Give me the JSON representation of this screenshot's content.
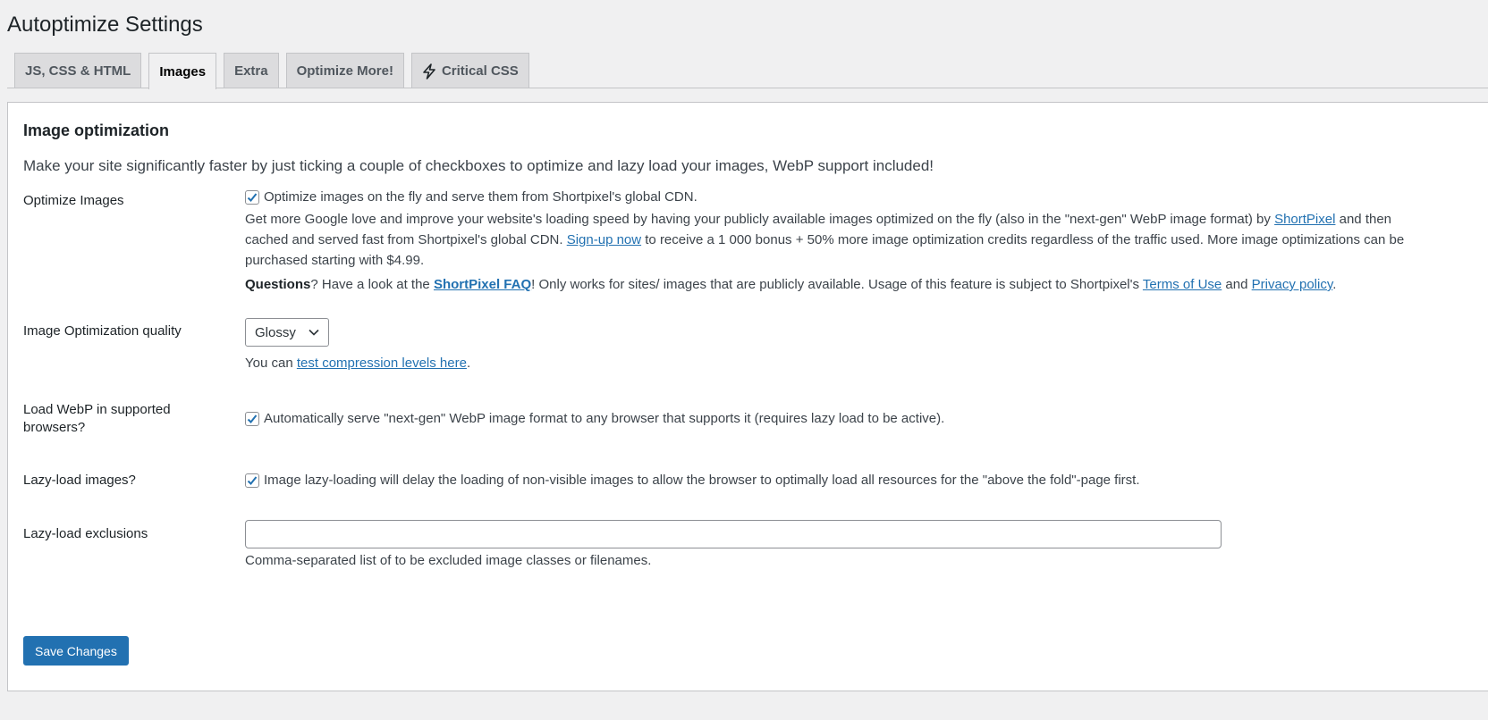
{
  "page": {
    "title": "Autoptimize Settings"
  },
  "tabs": [
    {
      "label": "JS, CSS & HTML"
    },
    {
      "label": "Images"
    },
    {
      "label": "Extra"
    },
    {
      "label": "Optimize More!"
    },
    {
      "label": "Critical CSS"
    }
  ],
  "active_tab": "Images",
  "section": {
    "title": "Image optimization",
    "intro": "Make your site significantly faster by just ticking a couple of checkboxes to optimize and lazy load your images, WebP support included!"
  },
  "optimize_images": {
    "label": "Optimize Images",
    "checked": true,
    "checkbox_text": "Optimize images on the fly and serve them from Shortpixel's global CDN.",
    "desc_part1": "Get more Google love and improve your website's loading speed by having your publicly available images optimized on the fly (also in the \"next-gen\" WebP image format) by ",
    "desc_link_shortpixel": "ShortPixel",
    "desc_part2": " and then",
    "desc_part3": "cached and served fast from Shortpixel's global CDN. ",
    "desc_link_signup": "Sign-up now",
    "desc_part4": " to receive a 1 000 bonus + 50% more image optimization credits regardless of the traffic used. More image optimizations can be",
    "desc_part5": "purchased starting with $4.99.",
    "questions_bold": "Questions",
    "questions_part1": "? Have a look at the ",
    "questions_link_faq": "ShortPixel FAQ",
    "questions_part2": "! Only works for sites/ images that are publicly available. Usage of this feature is subject to Shortpixel's ",
    "questions_link_terms": "Terms of Use",
    "questions_and": " and ",
    "questions_link_privacy": "Privacy policy",
    "questions_end": "."
  },
  "quality": {
    "label": "Image Optimization quality",
    "selected": "Glossy",
    "note_prefix": "You can ",
    "note_link": "test compression levels here",
    "note_suffix": "."
  },
  "webp": {
    "label": "Load WebP in supported browsers?",
    "checked": true,
    "checkbox_text": "Automatically serve \"next-gen\" WebP image format to any browser that supports it (requires lazy load to be active)."
  },
  "lazyload": {
    "label": "Lazy-load images?",
    "checked": true,
    "checkbox_text": "Image lazy-loading will delay the loading of non-visible images to allow the browser to optimally load all resources for the \"above the fold\"-page first."
  },
  "exclusions": {
    "label": "Lazy-load exclusions",
    "value": "",
    "note": "Comma-separated list of to be excluded image classes or filenames."
  },
  "save_button": {
    "label": "Save Changes"
  },
  "colors": {
    "accent": "#2271b1",
    "page_bg": "#f0f0f1",
    "panel_bg": "#ffffff"
  }
}
